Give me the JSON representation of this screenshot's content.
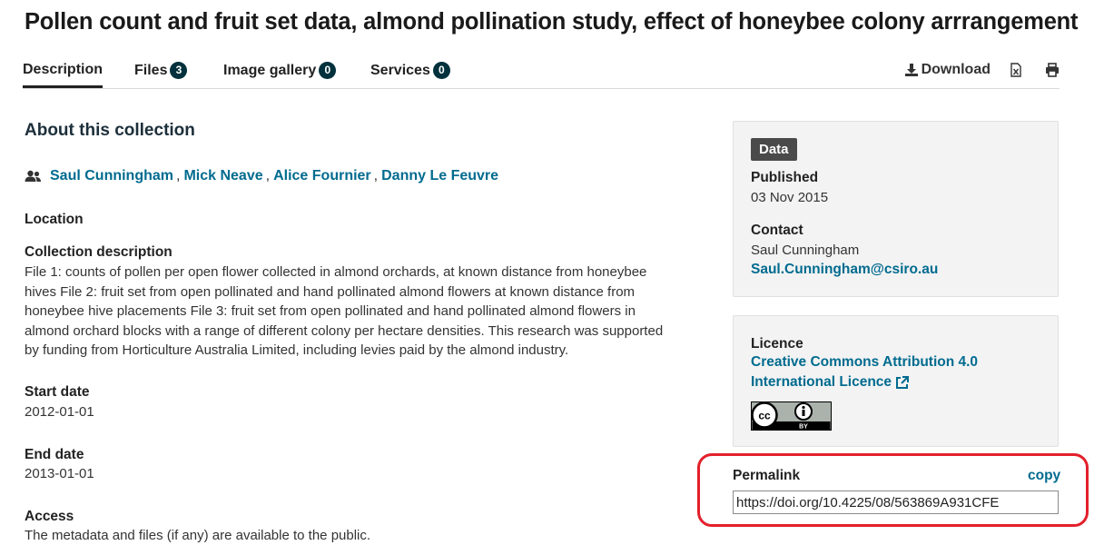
{
  "page": {
    "title": "Pollen count and fruit set data, almond pollination study, effect of honeybee colony arrrangement"
  },
  "tabs": [
    {
      "label": "Description",
      "badge": null,
      "active": true
    },
    {
      "label": "Files",
      "badge": "3",
      "active": false
    },
    {
      "label": "Image gallery",
      "badge": "0",
      "active": false
    },
    {
      "label": "Services",
      "badge": "0",
      "active": false
    }
  ],
  "toolbar": {
    "download_label": "Download",
    "download_icon": "download-icon",
    "export_icon": "excel-file-icon",
    "print_icon": "print-icon"
  },
  "main": {
    "section_title": "About this collection",
    "authors_icon": "people-icon",
    "authors": [
      "Saul Cunningham",
      "Mick Neave",
      "Alice Fournier",
      "Danny Le Feuvre"
    ],
    "author_separator": ",",
    "location_label": "Location",
    "description_label": "Collection description",
    "description_lines": [
      "File 1: counts of pollen per open flower collected in almond orchards, at known distance from honeybee",
      "hives File 2: fruit set from open pollinated and hand pollinated almond flowers at known distance from",
      "honeybee hive placements File 3: fruit set from open pollinated and hand pollinated almond flowers in",
      "almond orchard blocks with a range of different colony per hectare densities. This research was supported",
      "by funding from Horticulture Australia Limited, including levies paid by the almond industry."
    ],
    "start_date_label": "Start date",
    "start_date": "2012-01-01",
    "end_date_label": "End date",
    "end_date": "2013-01-01",
    "access_label": "Access",
    "access_text": "The metadata and files (if any) are available to the public."
  },
  "sidebar": {
    "type_tag": "Data",
    "published_label": "Published",
    "published_value": "03 Nov 2015",
    "contact_label": "Contact",
    "contact_name": "Saul Cunningham",
    "contact_email": "Saul.Cunningham@csiro.au",
    "licence_label": "Licence",
    "licence_line1": "Creative Commons Attribution 4.0",
    "licence_line2": "International Licence",
    "licence_external_icon": "external-link-icon",
    "cc_badge_icon": "cc-by-badge",
    "cc_badge_text": "BY",
    "permalink_label": "Permalink",
    "copy_label": "copy",
    "permalink_value": "https://doi.org/10.4225/08/563869A931CFE"
  },
  "colors": {
    "link": "#006b8f",
    "badge": "#00313c",
    "highlight": "#e3202b",
    "card_bg": "#f3f3f3",
    "tag_bg": "#4a4a4a"
  }
}
